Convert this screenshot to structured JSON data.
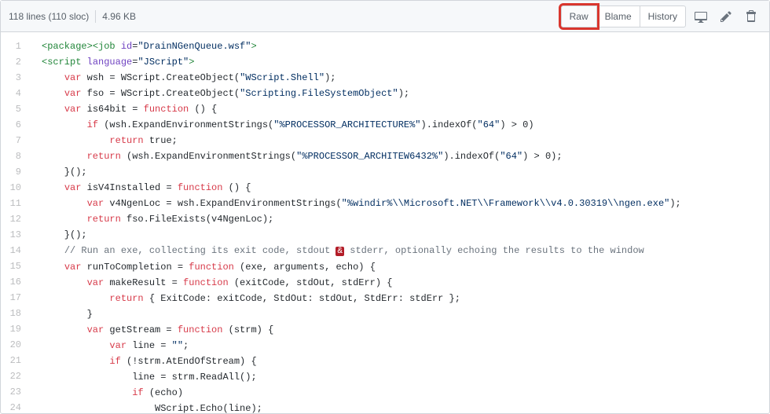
{
  "header": {
    "lines_info": "118 lines (110 sloc)",
    "size": "4.96 KB",
    "raw": "Raw",
    "blame": "Blame",
    "history": "History"
  },
  "code": {
    "start_line": 1,
    "lines": [
      {
        "n": 1,
        "t": "tag",
        "html": "<span class='c-tag'>&lt;package&gt;</span><span class='c-tag'>&lt;job</span> <span class='c-attr'>id</span>=<span class='c-str'>\"DrainNGenQueue.wsf\"</span><span class='c-tag'>&gt;</span>"
      },
      {
        "n": 2,
        "t": "tag",
        "html": "<span class='c-tag'>&lt;script</span> <span class='c-attr'>language</span>=<span class='c-str'>\"JScript\"</span><span class='c-tag'>&gt;</span>"
      },
      {
        "n": 3,
        "html": "    <span class='c-kw'>var</span> wsh = WScript.CreateObject(<span class='c-str'>\"WScript.Shell\"</span>);"
      },
      {
        "n": 4,
        "html": "    <span class='c-kw'>var</span> fso = WScript.CreateObject(<span class='c-str'>\"Scripting.FileSystemObject\"</span>);"
      },
      {
        "n": 5,
        "html": "    <span class='c-kw'>var</span> is64bit = <span class='c-kw'>function</span> () {"
      },
      {
        "n": 6,
        "html": "        <span class='c-kw'>if</span> (wsh.ExpandEnvironmentStrings(<span class='c-str'>\"%PROCESSOR_ARCHITECTURE%\"</span>).indexOf(<span class='c-str'>\"64\"</span>) &gt; 0)"
      },
      {
        "n": 7,
        "html": "            <span class='c-kw'>return</span> true;"
      },
      {
        "n": 8,
        "html": "        <span class='c-kw'>return</span> (wsh.ExpandEnvironmentStrings(<span class='c-str'>\"%PROCESSOR_ARCHITEW6432%\"</span>).indexOf(<span class='c-str'>\"64\"</span>) &gt; 0);"
      },
      {
        "n": 9,
        "html": "    }();"
      },
      {
        "n": 10,
        "html": "    <span class='c-kw'>var</span> isV4Installed = <span class='c-kw'>function</span> () {"
      },
      {
        "n": 11,
        "html": "        <span class='c-kw'>var</span> v4NgenLoc = wsh.ExpandEnvironmentStrings(<span class='c-str'>\"%windir%\\\\Microsoft.NET\\\\Framework\\\\v4.0.30319\\\\ngen.exe\"</span>);"
      },
      {
        "n": 12,
        "html": "        <span class='c-kw'>return</span> fso.FileExists(v4NgenLoc);"
      },
      {
        "n": 13,
        "html": "    }();"
      },
      {
        "n": 14,
        "html": "    <span class='c-cm'>// Run an exe, collecting its exit code, stdout <span class='redbox'>&amp;</span> stderr, optionally echoing the results to the window</span>"
      },
      {
        "n": 15,
        "html": "    <span class='c-kw'>var</span> runToCompletion = <span class='c-kw'>function</span> (exe, arguments, echo) {"
      },
      {
        "n": 16,
        "html": "        <span class='c-kw'>var</span> makeResult = <span class='c-kw'>function</span> (exitCode, stdOut, stdErr) {"
      },
      {
        "n": 17,
        "html": "            <span class='c-kw'>return</span> { ExitCode: exitCode, StdOut: stdOut, StdErr: stdErr };"
      },
      {
        "n": 18,
        "html": "        }"
      },
      {
        "n": 19,
        "html": "        <span class='c-kw'>var</span> getStream = <span class='c-kw'>function</span> (strm) {"
      },
      {
        "n": 20,
        "html": "            <span class='c-kw'>var</span> line = <span class='c-str'>\"\"</span>;"
      },
      {
        "n": 21,
        "html": "            <span class='c-kw'>if</span> (!strm.AtEndOfStream) {"
      },
      {
        "n": 22,
        "html": "                line = strm.ReadAll();"
      },
      {
        "n": 23,
        "html": "                <span class='c-kw'>if</span> (echo)"
      },
      {
        "n": 24,
        "html": "                    WScript.Echo(line);"
      }
    ]
  }
}
